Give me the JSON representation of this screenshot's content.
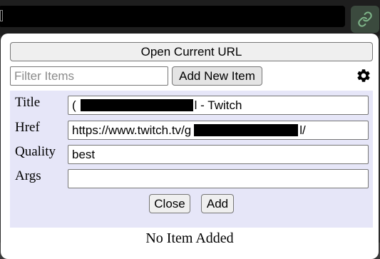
{
  "toolbar": {
    "address_bar_icon": "page-icon",
    "extension_icon": "link-icon",
    "accent_color": "#7fb68a"
  },
  "popup": {
    "open_current_url_label": "Open Current URL",
    "filter_placeholder": "Filter Items",
    "add_new_item_label": "Add New Item",
    "settings_icon": "gear-icon",
    "form": {
      "title_label": "Title",
      "title_value_prefix": "(",
      "title_value_suffix": "l - Twitch",
      "href_label": "Href",
      "href_value_prefix": "https://www.twitch.tv/g",
      "href_value_suffix": "l/",
      "quality_label": "Quality",
      "quality_value": "best",
      "args_label": "Args",
      "args_value": "",
      "close_label": "Close",
      "add_label": "Add",
      "panel_color": "#e6e6f8"
    },
    "status_text": "No Item Added"
  }
}
